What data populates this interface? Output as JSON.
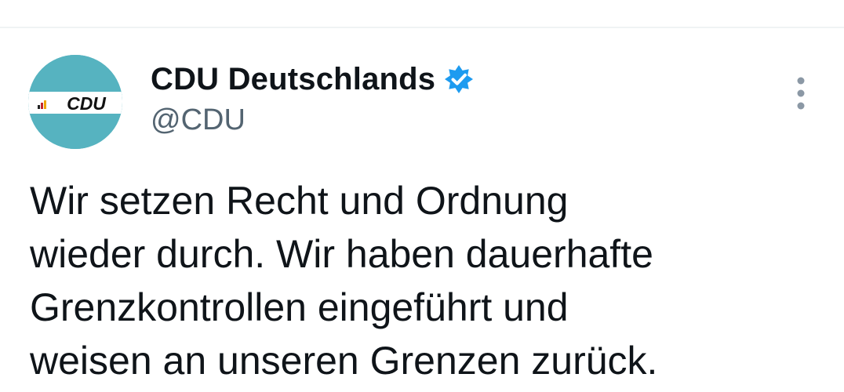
{
  "account": {
    "display_name": "CDU Deutschlands",
    "handle": "@CDU",
    "verified": true,
    "avatar_text": "CDU",
    "avatar_bg_color": "#56b3c0",
    "verified_color": "#1d9bf0"
  },
  "menu": {
    "icon": "more-vertical-icon"
  },
  "tweet": {
    "lines": [
      "Wir setzen Recht und Ordnung",
      "wieder durch. Wir haben dauerhafte",
      "Grenzkontrollen eingeführt und",
      "weisen an unseren Grenzen zurück."
    ]
  }
}
